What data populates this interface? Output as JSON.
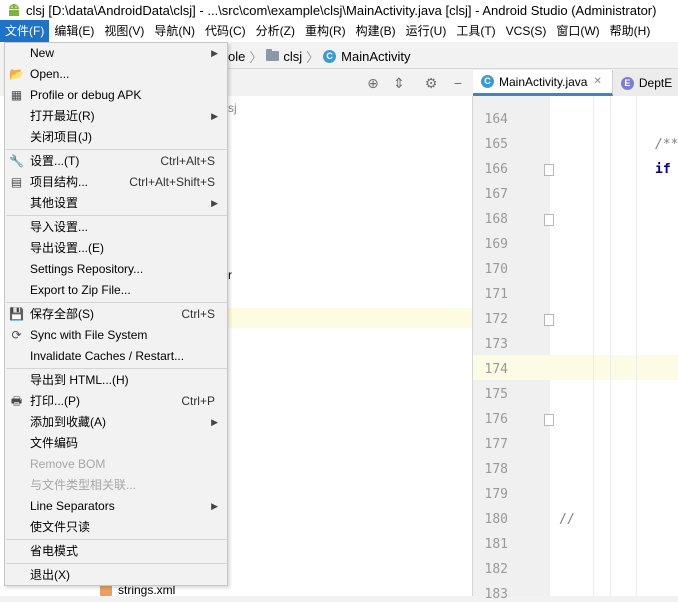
{
  "window": {
    "title": "clsj [D:\\data\\AndroidData\\clsj] - ...\\src\\com\\example\\clsj\\MainActivity.java [clsj] - Android Studio (Administrator)"
  },
  "menubar": {
    "items": [
      "文件(F)",
      "编辑(E)",
      "视图(V)",
      "导航(N)",
      "代码(C)",
      "分析(Z)",
      "重构(R)",
      "构建(B)",
      "运行(U)",
      "工具(T)",
      "VCS(S)",
      "窗口(W)",
      "帮助(H)"
    ]
  },
  "navbar": {
    "crumb1": "ole",
    "crumb2": "clsj",
    "crumb3": "MainActivity"
  },
  "editor": {
    "tabs": [
      {
        "label": "MainActivity.java",
        "icon": "class-icon"
      },
      {
        "label": "DeptE",
        "icon": "enum-icon"
      }
    ],
    "line_numbers": [
      "164",
      "165",
      "166",
      "167",
      "168",
      "169",
      "170",
      "171",
      "172",
      "173",
      "174",
      "175",
      "176",
      "177",
      "178",
      "179",
      "180",
      "181",
      "182",
      "183"
    ],
    "current_line": "174",
    "code": {
      "comment_start": "/**",
      "if_keyword": "if",
      "line_comment": "//"
    }
  },
  "tree": {
    "fragment1": "sj",
    "fragment2": "r",
    "strings_file": "strings.xml"
  },
  "file_menu": {
    "items": [
      {
        "label": "New",
        "shortcut": "",
        "submenu": true,
        "icon": ""
      },
      {
        "label": "Open...",
        "shortcut": "",
        "submenu": false,
        "icon": "folder-open-icon"
      },
      {
        "label": "Profile or debug APK",
        "shortcut": "",
        "submenu": false,
        "icon": "profile-apk-icon"
      },
      {
        "label": "打开最近(R)",
        "shortcut": "",
        "submenu": true,
        "icon": ""
      },
      {
        "label": "关闭项目(J)",
        "shortcut": "",
        "submenu": false,
        "icon": ""
      },
      {
        "label": "设置...(T)",
        "shortcut": "Ctrl+Alt+S",
        "submenu": false,
        "icon": "wrench-icon"
      },
      {
        "label": "项目结构...",
        "shortcut": "Ctrl+Alt+Shift+S",
        "submenu": false,
        "icon": "project-structure-icon"
      },
      {
        "label": "其他设置",
        "shortcut": "",
        "submenu": true,
        "icon": ""
      },
      {
        "label": "导入设置...",
        "shortcut": "",
        "submenu": false,
        "icon": ""
      },
      {
        "label": "导出设置...(E)",
        "shortcut": "",
        "submenu": false,
        "icon": ""
      },
      {
        "label": "Settings Repository...",
        "shortcut": "",
        "submenu": false,
        "icon": ""
      },
      {
        "label": "Export to Zip File...",
        "shortcut": "",
        "submenu": false,
        "icon": ""
      },
      {
        "label": "保存全部(S)",
        "shortcut": "Ctrl+S",
        "submenu": false,
        "icon": "save-icon"
      },
      {
        "label": "Sync with File System",
        "shortcut": "",
        "submenu": false,
        "icon": "sync-icon"
      },
      {
        "label": "Invalidate Caches / Restart...",
        "shortcut": "",
        "submenu": false,
        "icon": ""
      },
      {
        "label": "导出到 HTML...(H)",
        "shortcut": "",
        "submenu": false,
        "icon": ""
      },
      {
        "label": "打印...(P)",
        "shortcut": "Ctrl+P",
        "submenu": false,
        "icon": "print-icon"
      },
      {
        "label": "添加到收藏(A)",
        "shortcut": "",
        "submenu": true,
        "icon": ""
      },
      {
        "label": "文件编码",
        "shortcut": "",
        "submenu": false,
        "icon": ""
      },
      {
        "label": "Remove BOM",
        "shortcut": "",
        "submenu": false,
        "icon": "",
        "disabled": true
      },
      {
        "label": "与文件类型相关联...",
        "shortcut": "",
        "submenu": false,
        "icon": "",
        "disabled": true
      },
      {
        "label": "Line Separators",
        "shortcut": "",
        "submenu": true,
        "icon": ""
      },
      {
        "label": "使文件只读",
        "shortcut": "",
        "submenu": false,
        "icon": ""
      },
      {
        "label": "省电模式",
        "shortcut": "",
        "submenu": false,
        "icon": ""
      },
      {
        "label": "退出(X)",
        "shortcut": "",
        "submenu": false,
        "icon": ""
      }
    ]
  },
  "colors": {
    "menu_active": "#1e73c6",
    "class_icon": "#3d9bd1",
    "keyword": "#000080",
    "comment": "#808080"
  }
}
